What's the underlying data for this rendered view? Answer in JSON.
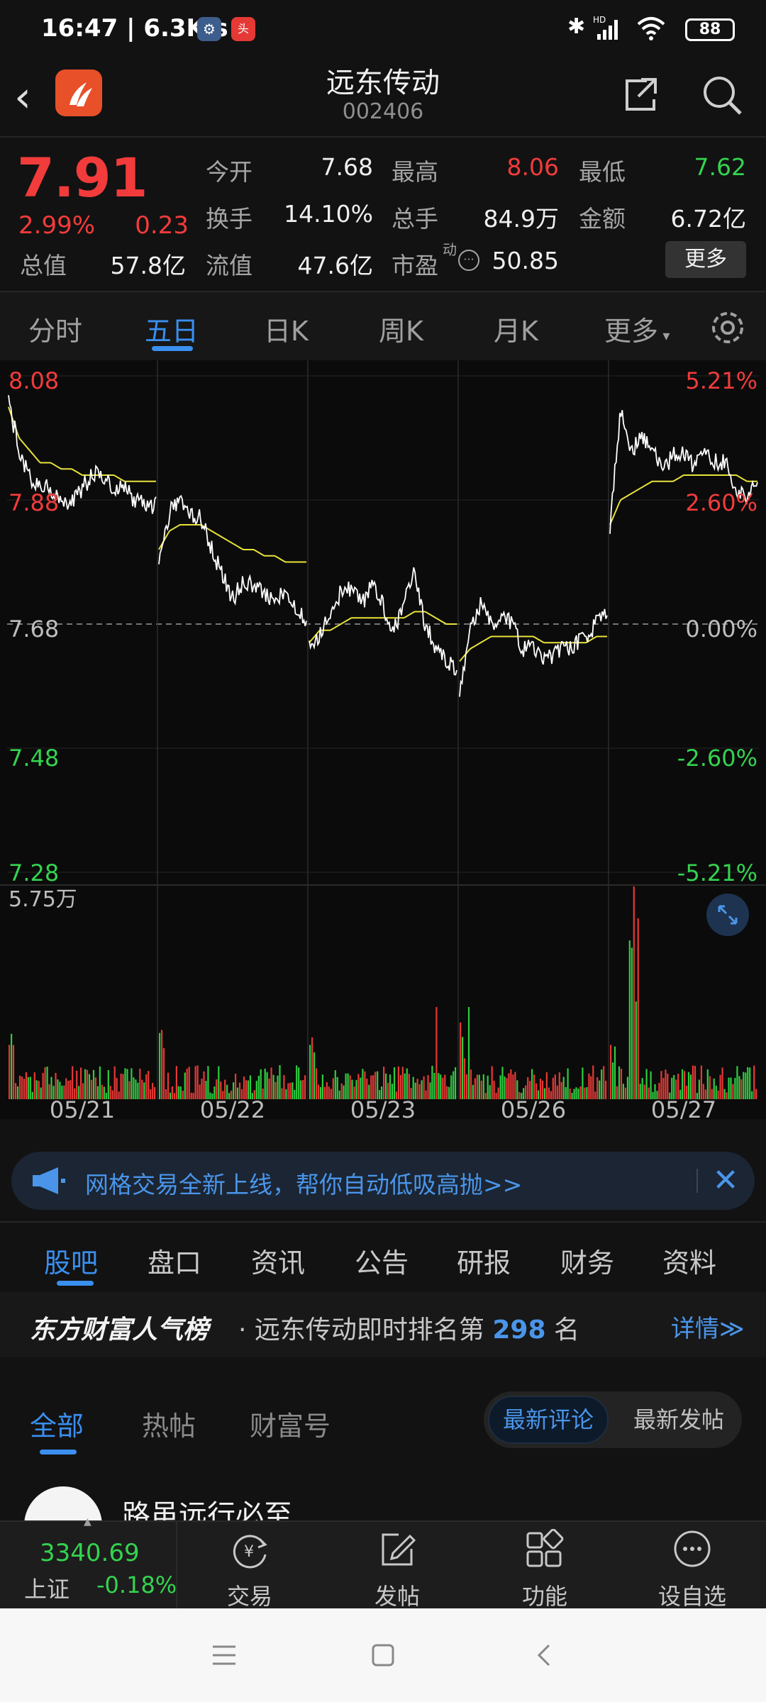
{
  "status_bar": {
    "time": "16:47",
    "net_speed": "6.3K/s",
    "battery": "88"
  },
  "header": {
    "title": "远东传动",
    "code": "002406"
  },
  "quote": {
    "price": "7.91",
    "change_pct": "2.99%",
    "change_amt": "0.23",
    "fields": [
      {
        "label": "今开",
        "value": "7.68",
        "color": "#f0f0f0"
      },
      {
        "label": "最高",
        "value": "8.06",
        "color": "#f23b3b"
      },
      {
        "label": "最低",
        "value": "7.62",
        "color": "#34d34f"
      },
      {
        "label": "换手",
        "value": "14.10%",
        "color": "#f0f0f0"
      },
      {
        "label": "总手",
        "value": "84.9万",
        "color": "#f0f0f0"
      },
      {
        "label": "金额",
        "value": "6.72亿",
        "color": "#f0f0f0"
      },
      {
        "label": "总值",
        "value": "57.8亿",
        "color": "#f0f0f0"
      },
      {
        "label": "流值",
        "value": "47.6亿",
        "color": "#f0f0f0"
      },
      {
        "label": "市盈",
        "value": "50.85",
        "color": "#f0f0f0"
      }
    ],
    "pe_superscript": "动",
    "more_label": "更多"
  },
  "chart_tabs": [
    "分时",
    "五日",
    "日K",
    "周K",
    "月K",
    "更多"
  ],
  "chart_tab_active": 1,
  "chart_data": {
    "type": "line",
    "title": "",
    "series": [
      {
        "name": "price",
        "color": "#ffffff"
      },
      {
        "name": "avg",
        "color": "#e8e23a"
      }
    ],
    "x_labels": [
      "05/21",
      "05/22",
      "05/23",
      "05/26",
      "05/27"
    ],
    "y_left_labels": [
      "8.08",
      "7.88",
      "7.68",
      "7.48",
      "7.28"
    ],
    "y_right_labels": [
      "5.21%",
      "2.60%",
      "0.00%",
      "-2.60%",
      "-5.21%"
    ],
    "ylim": [
      7.28,
      8.08
    ],
    "prev_close": 7.68,
    "volume_max_label": "5.75万",
    "days": [
      {
        "date": "05/21",
        "price": [
          8.04,
          7.96,
          7.92,
          7.9,
          7.9,
          7.87,
          7.88,
          7.9,
          7.92,
          7.92,
          7.9,
          7.9,
          7.88,
          7.87,
          7.87
        ],
        "avg": [
          8.03,
          7.98,
          7.96,
          7.94,
          7.94,
          7.93,
          7.93,
          7.92,
          7.92,
          7.92,
          7.92,
          7.91,
          7.91,
          7.91,
          7.91
        ]
      },
      {
        "date": "05/22",
        "price": [
          7.78,
          7.86,
          7.88,
          7.86,
          7.85,
          7.8,
          7.76,
          7.72,
          7.75,
          7.74,
          7.73,
          7.72,
          7.73,
          7.7,
          7.69
        ],
        "avg": [
          7.8,
          7.83,
          7.84,
          7.84,
          7.84,
          7.83,
          7.82,
          7.81,
          7.8,
          7.8,
          7.79,
          7.79,
          7.78,
          7.78,
          7.78
        ]
      },
      {
        "date": "05/23",
        "price": [
          7.65,
          7.66,
          7.7,
          7.73,
          7.74,
          7.71,
          7.75,
          7.71,
          7.67,
          7.71,
          7.77,
          7.68,
          7.64,
          7.62,
          7.61
        ],
        "avg": [
          7.65,
          7.67,
          7.67,
          7.68,
          7.69,
          7.69,
          7.69,
          7.69,
          7.69,
          7.69,
          7.7,
          7.7,
          7.69,
          7.68,
          7.68
        ]
      },
      {
        "date": "05/26",
        "price": [
          7.56,
          7.68,
          7.71,
          7.68,
          7.7,
          7.68,
          7.64,
          7.64,
          7.62,
          7.63,
          7.64,
          7.65,
          7.66,
          7.68,
          7.7
        ],
        "avg": [
          7.62,
          7.64,
          7.65,
          7.66,
          7.66,
          7.66,
          7.66,
          7.66,
          7.65,
          7.65,
          7.65,
          7.65,
          7.65,
          7.66,
          7.66
        ]
      },
      {
        "date": "05/27",
        "price": [
          7.84,
          8.02,
          7.96,
          7.98,
          7.96,
          7.93,
          7.95,
          7.96,
          7.93,
          7.96,
          7.94,
          7.94,
          7.9,
          7.88,
          7.91
        ],
        "avg": [
          7.84,
          7.88,
          7.89,
          7.9,
          7.91,
          7.91,
          7.91,
          7.92,
          7.92,
          7.92,
          7.92,
          7.92,
          7.92,
          7.91,
          7.91
        ]
      }
    ]
  },
  "promo_banner": {
    "text": "网格交易全新上线，帮你自动低吸高抛>>"
  },
  "content_tabs": [
    "股吧",
    "盘口",
    "资讯",
    "公告",
    "研报",
    "财务",
    "资料"
  ],
  "content_tab_active": 0,
  "popularity": {
    "brand": "东方财富人气榜",
    "prefix": "· 远东传动即时排名第",
    "rank": "298",
    "suffix": "名",
    "detail": "详情≫"
  },
  "feed_tabs": [
    "全部",
    "热帖",
    "财富号"
  ],
  "feed_tab_active": 0,
  "sort_options": {
    "active": "最新评论",
    "other": "最新发帖"
  },
  "post": {
    "author": "路虽远行必至"
  },
  "bottom_nav": {
    "index_value": "3340.69",
    "index_name": "上证",
    "index_change": "-0.18%",
    "items": [
      {
        "label": "交易",
        "icon": "yen-refresh-icon"
      },
      {
        "label": "发帖",
        "icon": "edit-icon"
      },
      {
        "label": "功能",
        "icon": "grid-icon"
      },
      {
        "label": "设自选",
        "icon": "more-icon"
      }
    ]
  }
}
